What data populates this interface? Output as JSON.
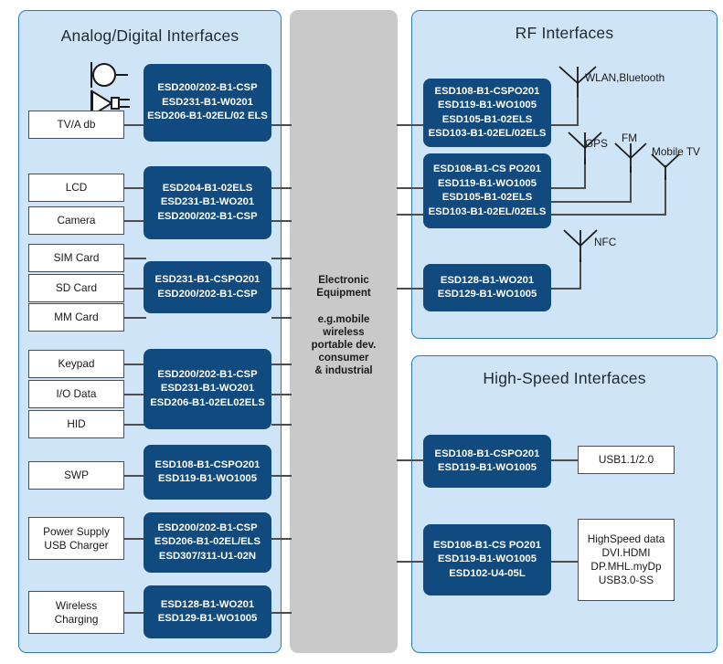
{
  "panels": {
    "analog": {
      "title": "Analog/Digital Interfaces"
    },
    "rf": {
      "title": "RF Interfaces"
    },
    "highspeed": {
      "title": "High-Speed Interfaces"
    }
  },
  "center": {
    "line1": "Electronic",
    "line2": "Equipment",
    "line3": "e.g.mobile",
    "line4": "wireless",
    "line5": "portable dev.",
    "line6": "consumer",
    "line7": "& industrial"
  },
  "analog": {
    "interfaces": [
      {
        "name": "tv-a-db",
        "label": "TV/A db"
      },
      {
        "name": "lcd",
        "label": "LCD"
      },
      {
        "name": "camera",
        "label": "Camera"
      },
      {
        "name": "sim-card",
        "label": "SIM Card"
      },
      {
        "name": "sd-card",
        "label": "SD Card"
      },
      {
        "name": "mm-card",
        "label": "MM Card"
      },
      {
        "name": "keypad",
        "label": "Keypad"
      },
      {
        "name": "io-data",
        "label": "I/O Data"
      },
      {
        "name": "hid",
        "label": "HID"
      },
      {
        "name": "swp",
        "label": "SWP"
      },
      {
        "name": "power-supply-usb-charger-l1",
        "label": "Power Supply"
      },
      {
        "name": "power-supply-usb-charger-l2",
        "label": "USB Charger"
      },
      {
        "name": "wireless-charging-l1",
        "label": "Wireless"
      },
      {
        "name": "wireless-charging-l2",
        "label": "Charging"
      }
    ],
    "devices": [
      {
        "name": "esd-group-tv-audio",
        "lines": [
          "ESD200/202-B1-CSP",
          "ESD231-B1-W0201",
          "ESD206-B1-02EL/02 ELS"
        ]
      },
      {
        "name": "esd-group-display-camera",
        "lines": [
          "ESD204-B1-02ELS",
          "ESD231-B1-WO201",
          "ESD200/202-B1-CSP"
        ]
      },
      {
        "name": "esd-group-cards",
        "lines": [
          "ESD231-B1-CSPO201",
          "ESD200/202-B1-CSP"
        ]
      },
      {
        "name": "esd-group-keypad-io-hid",
        "lines": [
          "ESD200/202-B1-CSP",
          "ESD231-B1-WO201",
          "ESD206-B1-02EL02ELS"
        ]
      },
      {
        "name": "esd-group-swp",
        "lines": [
          "ESD108-B1-CSPO201",
          "ESD119-B1-WO1005"
        ]
      },
      {
        "name": "esd-group-power",
        "lines": [
          "ESD200/202-B1-CSP",
          "ESD206-B1-02EL/ELS",
          "ESD307/311-U1-02N"
        ]
      },
      {
        "name": "esd-group-wireless-charging",
        "lines": [
          "ESD128-B1-WO201",
          "ESD129-B1-WO1005"
        ]
      }
    ]
  },
  "rf": {
    "devices": [
      {
        "name": "esd-group-rf-top",
        "lines": [
          "ESD108-B1-CSPO201",
          "ESD119-B1-WO1005",
          "ESD105-B1-02ELS",
          "ESD103-B1-02EL/02ELS"
        ]
      },
      {
        "name": "esd-group-rf-mid",
        "lines": [
          "ESD108-B1-CS PO201",
          "ESD119-B1-WO1005",
          "ESD105-B1-02ELS",
          "ESD103-B1-02EL/02ELS"
        ]
      },
      {
        "name": "esd-group-nfc",
        "lines": [
          "ESD128-B1-WO201",
          "ESD129-B1-WO1005"
        ]
      }
    ],
    "antennas": [
      {
        "name": "antenna-wlan-bluetooth",
        "label": "WLAN,Bluetooth"
      },
      {
        "name": "antenna-gps",
        "label": "GPS"
      },
      {
        "name": "antenna-fm",
        "label": "FM"
      },
      {
        "name": "antenna-mobile-tv",
        "label": "Mobile TV"
      },
      {
        "name": "antenna-nfc",
        "label": "NFC"
      }
    ]
  },
  "highspeed": {
    "devices": [
      {
        "name": "esd-group-usb",
        "lines": [
          "ESD108-B1-CSPO201",
          "ESD119-B1-WO1005"
        ]
      },
      {
        "name": "esd-group-highspeed-data",
        "lines": [
          "ESD108-B1-CS PO201",
          "ESD119-B1-WO1005",
          "ESD102-U4-05L"
        ]
      }
    ],
    "ports": [
      {
        "name": "usb-port",
        "lines": [
          "USB1.1/2.0"
        ]
      },
      {
        "name": "highspeed-data-port",
        "lines": [
          "HighSpeed data",
          "DVI.HDMI",
          "DP.MHL.myDp",
          "USB3.0-SS"
        ]
      }
    ]
  },
  "icons": {
    "microphone": "microphone-icon",
    "speaker": "speaker-icon"
  },
  "colors": {
    "panel_fill": "#cfe4f7",
    "panel_border": "#2a7bc0",
    "device_fill": "#114a7e",
    "center_fill": "#c9c9c9",
    "line": "#4d4d4d"
  }
}
